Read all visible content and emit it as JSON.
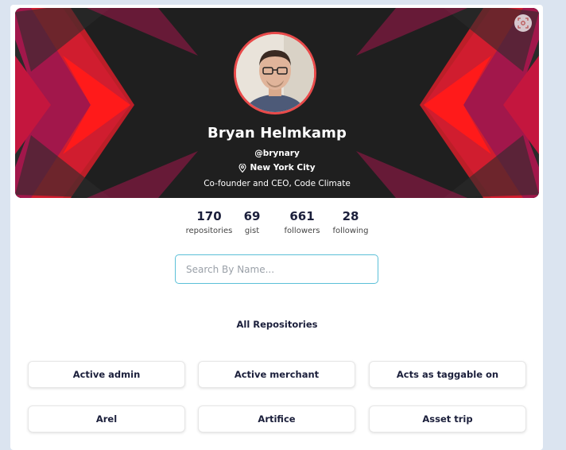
{
  "profile": {
    "name": "Bryan Helmkamp",
    "handle": "@brynary",
    "location": "New York City",
    "bio": "Co-founder and CEO, Code Climate"
  },
  "stats": [
    {
      "value": "170",
      "label": "repositories"
    },
    {
      "value": "69",
      "label": "gist"
    },
    {
      "value": "661",
      "label": "followers"
    },
    {
      "value": "28",
      "label": "following"
    }
  ],
  "search": {
    "placeholder": "Search By Name...",
    "value": ""
  },
  "repositories": {
    "title": "All Repositories",
    "items": [
      "Active admin",
      "Active merchant",
      "Acts as taggable on",
      "Arel",
      "Artifice",
      "Asset trip"
    ]
  },
  "colors": {
    "accent_red": "#e81c1c",
    "accent_magenta": "#b01650",
    "banner_bg": "#1f1f1f",
    "search_border": "#5bc0d8"
  },
  "icons": {
    "screenshot": "screenshot-icon",
    "location": "location-pin-icon"
  }
}
